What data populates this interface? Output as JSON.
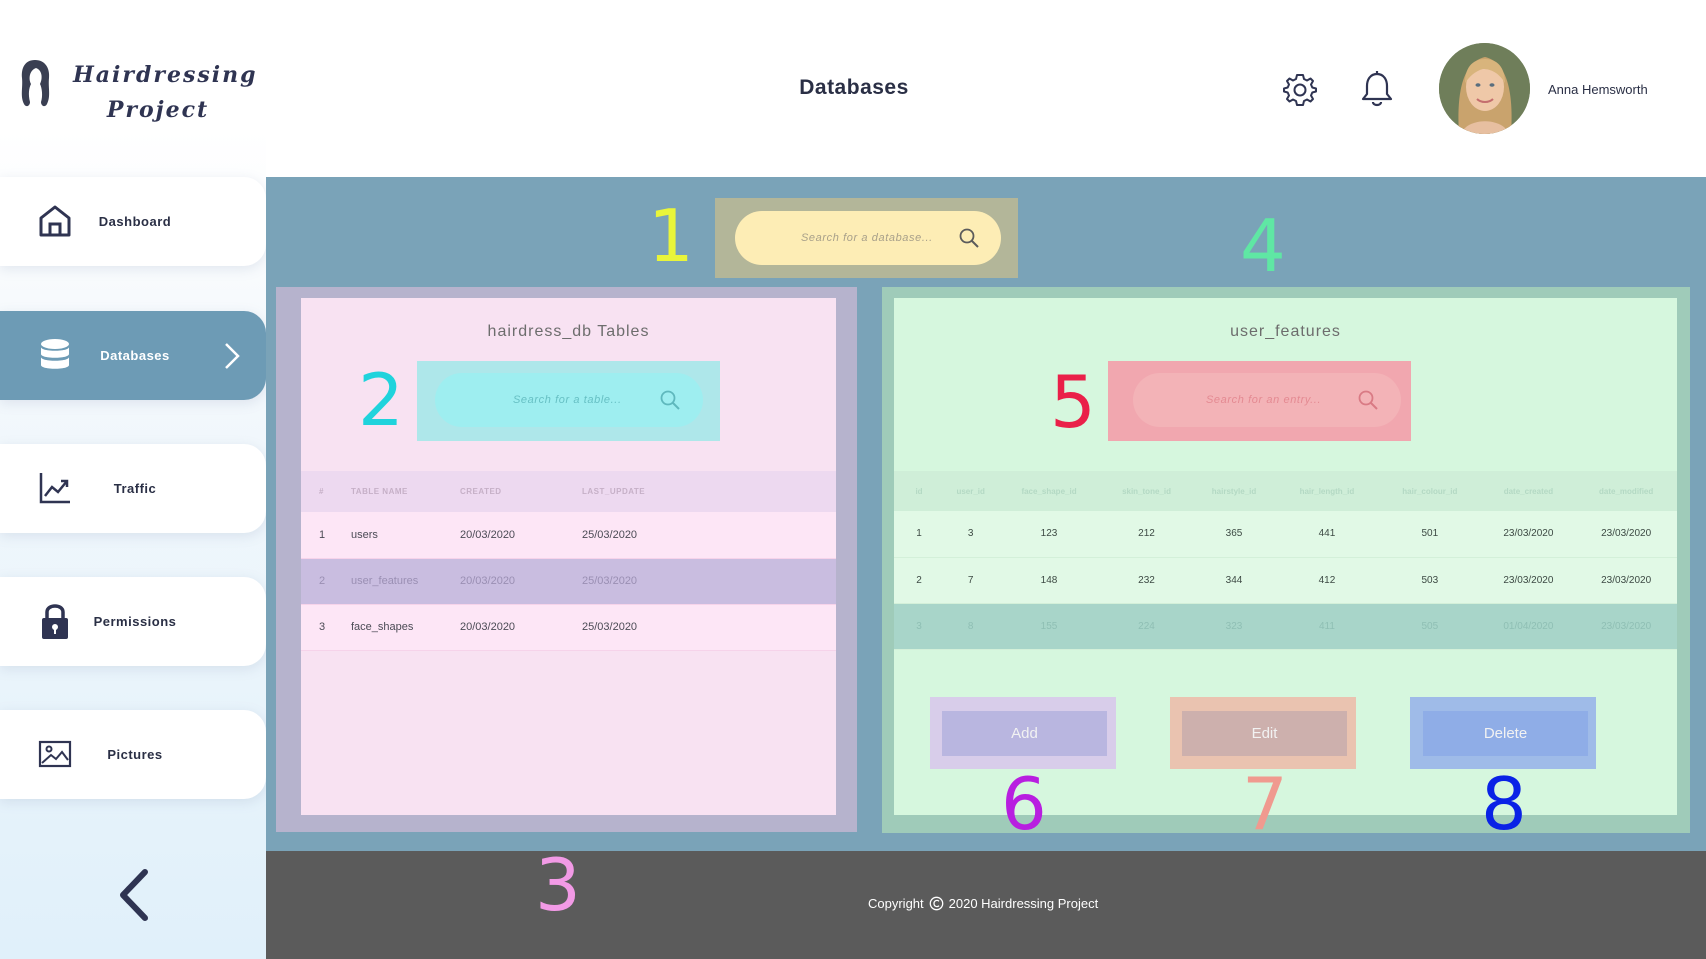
{
  "header": {
    "logo_line1": "Hairdressing",
    "logo_line2": "Project",
    "page_title": "Databases",
    "user_name": "Anna Hemsworth",
    "icons": [
      "settings-gear-icon",
      "notification-bell-icon"
    ]
  },
  "sidebar": {
    "items": [
      {
        "label": "Dashboard",
        "icon": "home-icon"
      },
      {
        "label": "Databases",
        "icon": "database-icon",
        "active": true
      },
      {
        "label": "Traffic",
        "icon": "chart-line-icon"
      },
      {
        "label": "Permissions",
        "icon": "lock-icon"
      },
      {
        "label": "Pictures",
        "icon": "image-icon"
      }
    ],
    "collapse_icon": "chevron-left-icon"
  },
  "search_database": {
    "placeholder": "Search for a database..."
  },
  "tables_panel": {
    "title": "hairdress_db Tables",
    "search_placeholder": "Search for a table...",
    "columns": [
      "#",
      "TABLE NAME",
      "CREATED",
      "LAST_UPDATE"
    ],
    "rows": [
      [
        "1",
        "users",
        "20/03/2020",
        "25/03/2020"
      ],
      [
        "2",
        "user_features",
        "20/03/2020",
        "25/03/2020"
      ],
      [
        "3",
        "face_shapes",
        "20/03/2020",
        "25/03/2020"
      ]
    ]
  },
  "features_panel": {
    "title": "user_features",
    "search_placeholder": "Search for an entry...",
    "columns": [
      "id",
      "user_id",
      "face_shape_id",
      "skin_tone_id",
      "hairstyle_id",
      "hair_length_id",
      "hair_colour_id",
      "date_created",
      "date_modified"
    ],
    "rows": [
      [
        "1",
        "3",
        "123",
        "212",
        "365",
        "441",
        "501",
        "23/03/2020",
        "23/03/2020"
      ],
      [
        "2",
        "7",
        "148",
        "232",
        "344",
        "412",
        "503",
        "23/03/2020",
        "23/03/2020"
      ],
      [
        "3",
        "8",
        "155",
        "224",
        "323",
        "411",
        "505",
        "01/04/2020",
        "23/03/2020"
      ]
    ],
    "buttons": {
      "add": "Add",
      "edit": "Edit",
      "delete": "Delete"
    }
  },
  "footer": {
    "copyright_prefix": "Copyright",
    "copyright_text": "2020 Hairdressing Project"
  },
  "annotations": [
    "1",
    "2",
    "3",
    "4",
    "5",
    "6",
    "7",
    "8"
  ],
  "colors": {
    "accent": "#6d9bb5",
    "main_bg": "#7aa3b8",
    "footer_bg": "#5b5b5b",
    "annotation_1": "#e9f53a",
    "annotation_2": "#1fd3dc",
    "annotation_3": "#f29ae6",
    "annotation_4": "#5fe7a4",
    "annotation_5": "#ea2049",
    "annotation_6": "#b81fe0",
    "annotation_7": "#f09a8f",
    "annotation_8": "#0a22e6"
  }
}
